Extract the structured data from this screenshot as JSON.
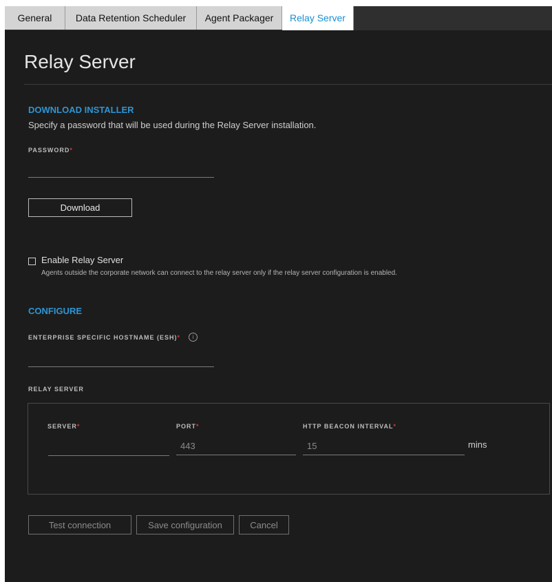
{
  "tabs": [
    {
      "label": "General"
    },
    {
      "label": "Data Retention Scheduler"
    },
    {
      "label": "Agent Packager"
    },
    {
      "label": "Relay Server"
    }
  ],
  "page": {
    "title": "Relay Server"
  },
  "download": {
    "heading": "DOWNLOAD INSTALLER",
    "description": "Specify a password that will be used during the Relay Server installation.",
    "password_label": "PASSWORD",
    "required_mark": "*",
    "password_value": "",
    "button": "Download"
  },
  "enable": {
    "label": "Enable Relay Server",
    "checked": false,
    "help": "Agents outside the corporate network can connect to the relay server only if the relay server configuration is enabled."
  },
  "configure": {
    "heading": "CONFIGURE",
    "esh_label": "ENTERPRISE SPECIFIC HOSTNAME (ESH)",
    "esh_value": "",
    "info_icon": "info-icon",
    "relay_section_label": "RELAY SERVER",
    "server_label": "SERVER",
    "server_value": "",
    "port_label": "PORT",
    "port_value": "443",
    "beacon_label": "HTTP BEACON INTERVAL",
    "beacon_value": "15",
    "beacon_unit": "mins"
  },
  "actions": {
    "test": "Test connection",
    "save": "Save configuration",
    "cancel": "Cancel"
  },
  "colors": {
    "accent": "#2e95d3",
    "panel_bg": "#1c1c1c",
    "required": "#d53b3b"
  }
}
